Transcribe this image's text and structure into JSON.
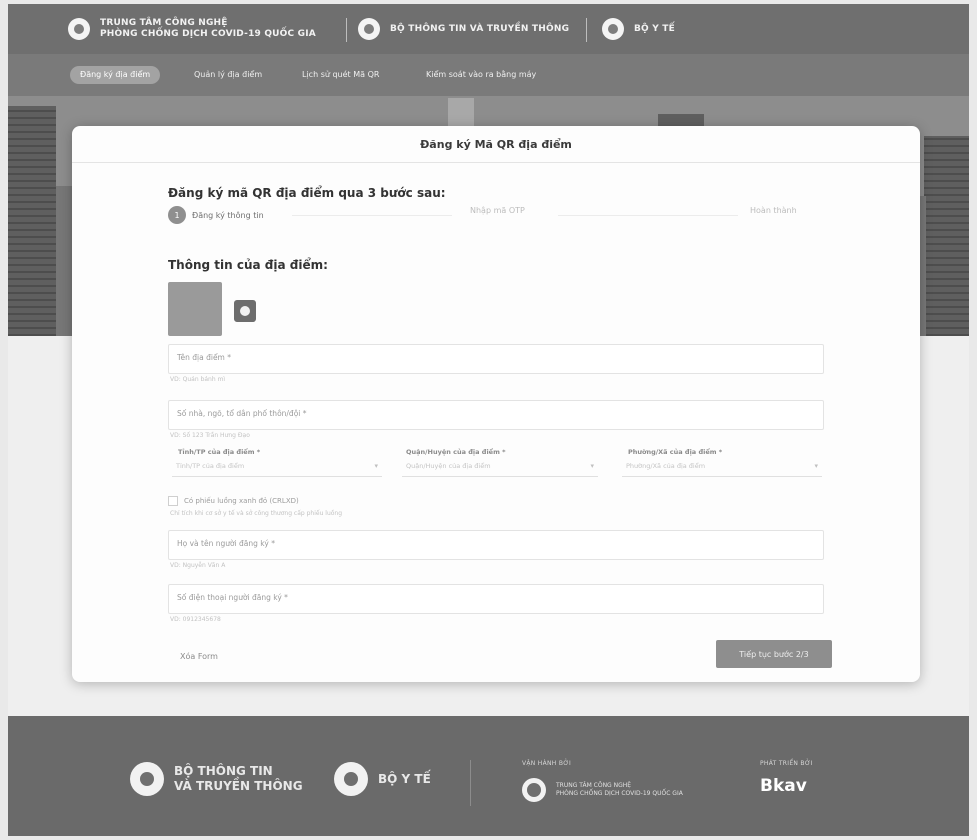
{
  "header": {
    "center_line1": "TRUNG TÂM CÔNG NGHỆ",
    "center_line2": "PHÒNG CHỐNG DỊCH COVID-19 QUỐC GIA",
    "ministry_ict": "BỘ THÔNG TIN VÀ TRUYỀN THÔNG",
    "ministry_health": "BỘ Y TẾ"
  },
  "nav": {
    "items": [
      {
        "label": "Đăng ký địa điểm",
        "active": true
      },
      {
        "label": "Quản lý địa điểm",
        "active": false
      },
      {
        "label": "Lịch sử quét Mã QR",
        "active": false
      },
      {
        "label": "Kiểm soát vào ra bằng máy",
        "active": false
      }
    ]
  },
  "card": {
    "title": "Đăng ký Mã QR địa điểm",
    "steps_heading": "Đăng ký mã QR địa điểm qua 3 bước sau:",
    "steps": [
      {
        "num": "1",
        "label": "Đăng ký thông tin"
      },
      {
        "label": "Nhập mã OTP"
      },
      {
        "label": "Hoàn thành"
      }
    ],
    "section_heading": "Thông tin của địa điểm:",
    "fields": {
      "name": {
        "label": "Tên địa điểm *",
        "help": "VD: Quán bánh mì"
      },
      "address": {
        "label": "Số nhà, ngõ, tổ dân phố thôn/đội *",
        "help": "VD: Số 123 Trần Hưng Đạo"
      },
      "province": {
        "label": "Tỉnh/TP của địa điểm *",
        "placeholder": "Tỉnh/TP của địa điểm"
      },
      "district": {
        "label": "Quận/Huyện của địa điểm *",
        "placeholder": "Quận/Huyện của địa điểm"
      },
      "ward": {
        "label": "Phường/Xã của địa điểm *",
        "placeholder": "Phường/Xã của địa điểm"
      },
      "green_zone": {
        "label": "Có phiếu luồng xanh đỏ (CRLXD)",
        "help": "Chỉ tích khi cơ sở y tế và sở công thương cấp phiếu luồng"
      },
      "registrant": {
        "label": "Họ và tên người đăng ký *",
        "help": "VD: Nguyễn Văn A"
      },
      "phone": {
        "label": "Số điện thoại người đăng ký *",
        "help": "VD: 0912345678"
      }
    },
    "reset_label": "Xóa Form",
    "next_label": "Tiếp tục bước 2/3"
  },
  "footer": {
    "ict_line1": "BỘ THÔNG TIN",
    "ict_line2": "VÀ TRUYỀN THÔNG",
    "health": "BỘ Y TẾ",
    "operated_by": "VẬN HÀNH BỞI",
    "center_line1": "TRUNG TÂM CÔNG NGHỆ",
    "center_line2": "PHÒNG CHỐNG DỊCH COVID-19 QUỐC GIA",
    "developed_by": "PHÁT TRIỂN BỞI",
    "developer": "Bkav"
  }
}
